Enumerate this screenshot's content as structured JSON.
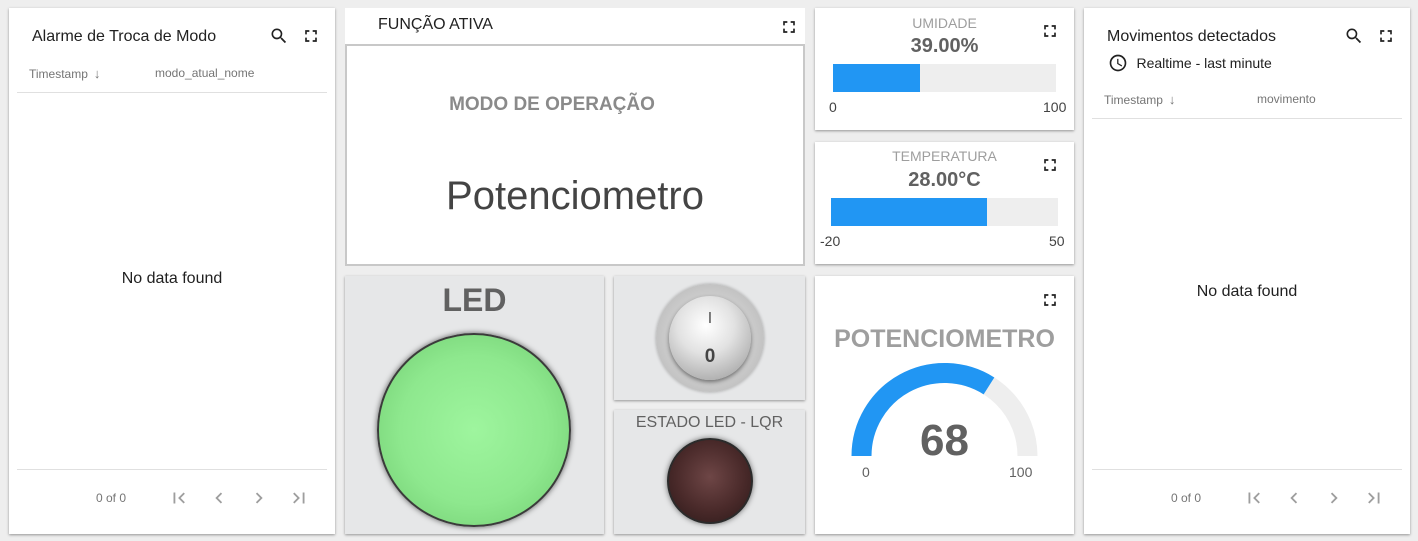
{
  "alarm_widget": {
    "title": "Alarme de Troca de Modo",
    "columns": [
      "Timestamp",
      "modo_atual_nome"
    ],
    "empty_text": "No data found",
    "pager_count": "0 of 0"
  },
  "funcao_ativa": {
    "title": "FUNÇÃO ATIVA",
    "label": "MODO DE OPERAÇÃO",
    "value": "Potenciometro"
  },
  "umidade": {
    "label": "UMIDADE",
    "value_text": "39.00%",
    "value": 39,
    "min": 0,
    "max": 100
  },
  "temperatura": {
    "label": "TEMPERATURA",
    "value_text": "28.00°C",
    "value": 28,
    "min": -20,
    "max": 50
  },
  "movimentos_widget": {
    "title": "Movimentos detectados",
    "timewindow": "Realtime - last minute",
    "columns": [
      "Timestamp",
      "movimento"
    ],
    "empty_text": "No data found",
    "pager_count": "0 of 0"
  },
  "led_widget": {
    "title": "LED",
    "color": "#8ee88e",
    "on": true
  },
  "switch_widget": {
    "on_label": "I",
    "off_label": "0",
    "state": "off"
  },
  "estado_led": {
    "title": "ESTADO LED - LQR",
    "color": "#4a2a2a",
    "on": false
  },
  "potenciometro": {
    "title": "POTENCIOMETRO",
    "value_text": "68",
    "value": 68,
    "min_label": "0",
    "max_label": "100",
    "min": 0,
    "max": 100,
    "accent": "#2196f3"
  },
  "icons": {
    "search": "search-icon",
    "fullscreen": "fullscreen-icon",
    "clock": "clock-icon",
    "first": "first-page-icon",
    "prev": "chevron-left-icon",
    "next": "chevron-right-icon",
    "last": "last-page-icon"
  }
}
